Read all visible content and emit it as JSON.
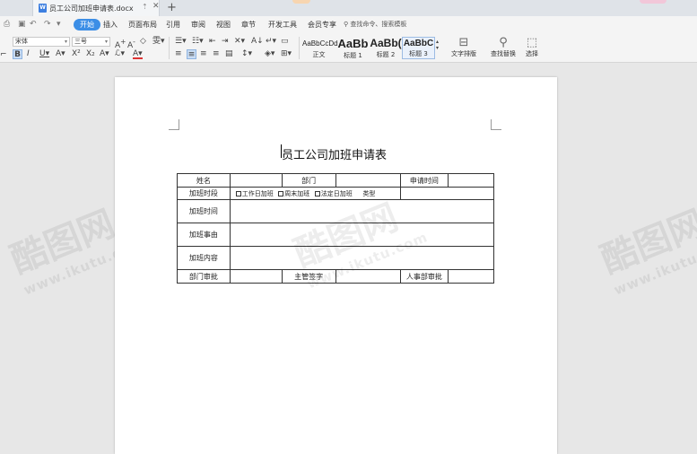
{
  "tab": {
    "filename": "员工公司加班申请表.docx",
    "new_tab": "+"
  },
  "menu": {
    "items": [
      "开始",
      "插入",
      "页面布局",
      "引用",
      "审阅",
      "视图",
      "章节",
      "开发工具",
      "会员专享"
    ],
    "search_placeholder": "查找命令、搜索模板"
  },
  "ribbon": {
    "font_name": "宋体",
    "font_size": "三号",
    "styles": [
      {
        "sample": "AaBbCcDd",
        "label": "正文"
      },
      {
        "sample": "AaBb",
        "label": "标题 1"
      },
      {
        "sample": "AaBb(",
        "label": "标题 2"
      },
      {
        "sample": "AaBbC",
        "label": "标题 3"
      }
    ],
    "text_layout_label": "文字排版",
    "find_replace_label": "查找替换",
    "select_label": "选择"
  },
  "document": {
    "title": "员工公司加班申请表",
    "form": {
      "name_label": "姓名",
      "dept_label": "部门",
      "apply_time_label": "申请时间",
      "period_label": "加班时段",
      "options": [
        "工作日加班",
        "周末加班",
        "法定日加班"
      ],
      "type_label": "类型",
      "overtime_time_label": "加班时间",
      "reason_label": "加班事由",
      "content_label": "加班内容",
      "dept_approval_label": "部门审批",
      "supervisor_sign_label": "主管签字",
      "hr_approval_label": "人事部审批"
    }
  },
  "watermark": {
    "brand": "酷图网",
    "url": "www.ikutu.com"
  },
  "colors": {
    "accent": "#3c8ee6",
    "tab_bg": "#dfe3e8",
    "canvas": "#e7e7e7"
  }
}
